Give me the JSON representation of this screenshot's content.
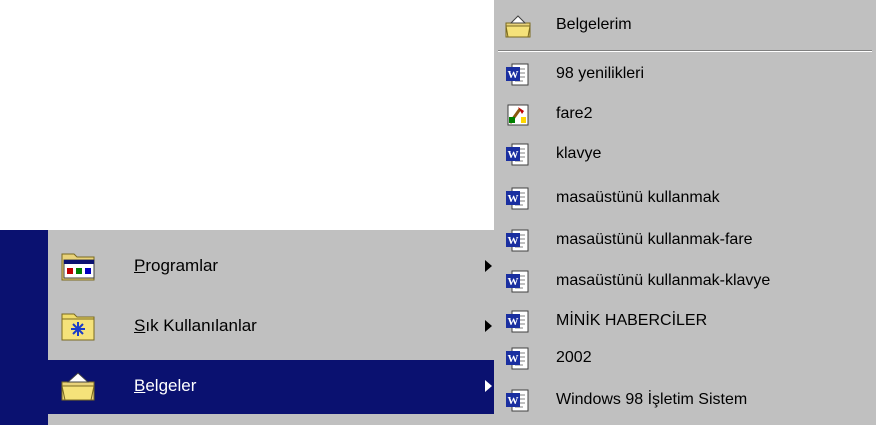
{
  "start_menu": {
    "items": [
      {
        "mnemonic": "P",
        "rest": "rogramlar",
        "icon": "programs-folder-icon",
        "has_submenu": true
      },
      {
        "mnemonic": "S",
        "rest": "ık Kullanılanlar",
        "icon": "favorites-folder-icon",
        "has_submenu": true
      },
      {
        "mnemonic": "B",
        "rest": "elgeler",
        "icon": "documents-folder-icon",
        "has_submenu": true,
        "highlighted": true
      }
    ]
  },
  "documents_submenu": {
    "header": {
      "label": "Belgelerim",
      "icon": "my-documents-folder-icon"
    },
    "items": [
      {
        "label": "98 yenilikleri",
        "icon": "word-document-icon"
      },
      {
        "label": "fare2",
        "icon": "paint-document-icon"
      },
      {
        "label": "klavye",
        "icon": "word-document-icon"
      },
      {
        "label": "masaüstünü kullanmak",
        "icon": "word-document-icon"
      },
      {
        "label": "masaüstünü kullanmak-fare",
        "icon": "word-document-icon"
      },
      {
        "label": "masaüstünü kullanmak-klavye",
        "icon": "word-document-icon"
      },
      {
        "label": "MİNİK HABERCİLER",
        "icon": "word-document-icon"
      },
      {
        "label": "2002",
        "icon": "word-document-icon"
      },
      {
        "label": "Windows 98 İşletim Sistem",
        "icon": "word-document-icon"
      }
    ]
  },
  "colors": {
    "menu_bg": "#c0c0c0",
    "highlight": "#0a1170",
    "side_band": "#0a1170"
  }
}
